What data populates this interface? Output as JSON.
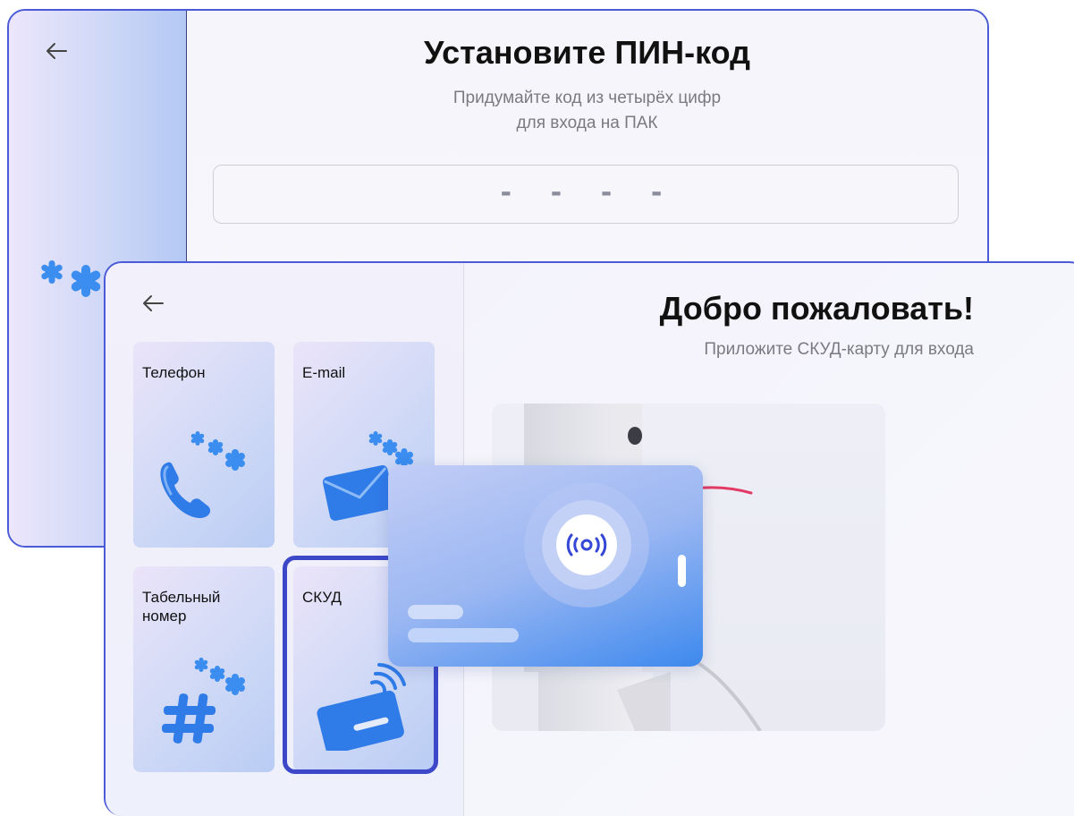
{
  "pin_screen": {
    "title": "Установите ПИН-код",
    "subtitle_line1": "Придумайте код из четырёх цифр",
    "subtitle_line2": "для входа на ПАК",
    "pin_placeholder": "- - - -"
  },
  "welcome_screen": {
    "title": "Добро пожаловать!",
    "subtitle": "Приложите СКУД-карту для входа",
    "login_methods": [
      {
        "label": "Телефон",
        "icon": "phone-icon"
      },
      {
        "label": "E-mail",
        "icon": "envelope-icon"
      },
      {
        "label": "Табельный номер",
        "icon": "hash-icon"
      },
      {
        "label": "СКУД",
        "icon": "access-card-icon"
      }
    ],
    "selected_method": "СКУД"
  },
  "colors": {
    "accent": "#3d48c8",
    "icon_blue": "#2f7be8",
    "card_gradient_end": "#3d89ee"
  }
}
